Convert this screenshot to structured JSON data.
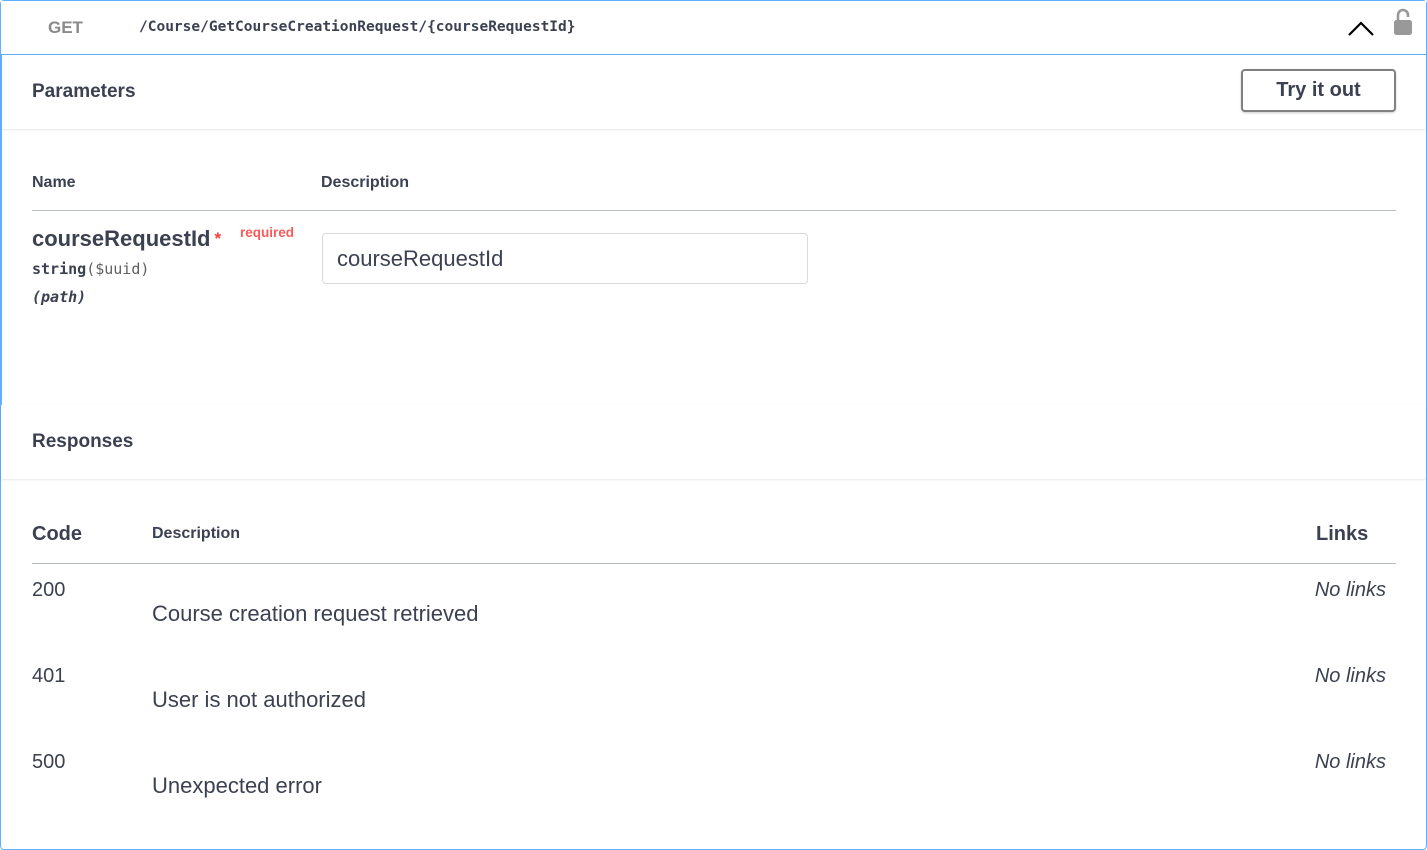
{
  "operation": {
    "method": "GET",
    "path": "/Course/GetCourseCreationRequest/{courseRequestId}"
  },
  "parameters": {
    "title": "Parameters",
    "try_label": "Try it out",
    "headers": {
      "name": "Name",
      "description": "Description"
    },
    "items": [
      {
        "name": "courseRequestId",
        "required_star": "*",
        "required_label": "required",
        "type": "string",
        "format": "($uuid)",
        "location": "(path)",
        "placeholder": "courseRequestId"
      }
    ]
  },
  "responses": {
    "title": "Responses",
    "headers": {
      "code": "Code",
      "description": "Description",
      "links": "Links"
    },
    "rows": [
      {
        "code": "200",
        "description": "Course creation request retrieved",
        "links": "No links"
      },
      {
        "code": "401",
        "description": "User is not authorized",
        "links": "No links"
      },
      {
        "code": "500",
        "description": "Unexpected error",
        "links": "No links"
      }
    ]
  },
  "colors": {
    "get_accent": "#61afe5",
    "required": "#f93e3e",
    "text": "#3b4151"
  },
  "icons": {
    "collapse": "chevron-up-icon",
    "auth": "lock-icon"
  }
}
